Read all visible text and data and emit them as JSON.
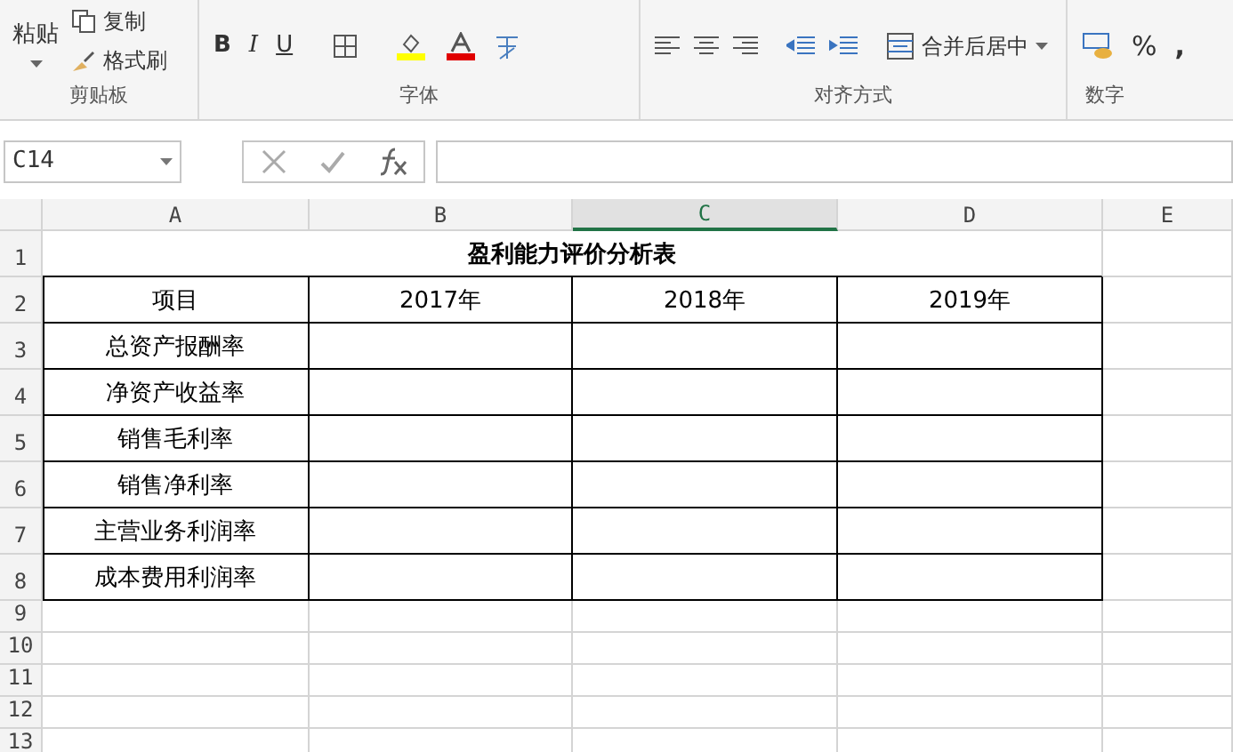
{
  "ribbon": {
    "clipboard": {
      "paste": "粘贴",
      "copy": "复制",
      "format_painter": "格式刷",
      "label": "剪贴板"
    },
    "font": {
      "bold": "B",
      "italic": "I",
      "underline": "U",
      "label": "字体"
    },
    "alignment": {
      "merge": "合并后居中",
      "label": "对齐方式"
    },
    "number": {
      "percent": "%",
      "comma": ",",
      "label": "数字"
    }
  },
  "formula_bar": {
    "name_box": "C14"
  },
  "sheet": {
    "columns": [
      {
        "label": "A",
        "selected": false
      },
      {
        "label": "B",
        "selected": false
      },
      {
        "label": "C",
        "selected": true
      },
      {
        "label": "D",
        "selected": false
      },
      {
        "label": "E",
        "selected": false
      }
    ],
    "rows": [
      {
        "header": "1",
        "kind": "title",
        "title": "盈利能力评价分析表"
      },
      {
        "header": "2",
        "kind": "table",
        "cells": [
          "项目",
          "2017年",
          "2018年",
          "2019年"
        ]
      },
      {
        "header": "3",
        "kind": "table",
        "cells": [
          "总资产报酬率"
        ]
      },
      {
        "header": "4",
        "kind": "table",
        "cells": [
          "净资产收益率"
        ]
      },
      {
        "header": "5",
        "kind": "table",
        "cells": [
          "销售毛利率"
        ]
      },
      {
        "header": "6",
        "kind": "table",
        "cells": [
          "销售净利率"
        ]
      },
      {
        "header": "7",
        "kind": "table",
        "cells": [
          "主营业务利润率"
        ]
      },
      {
        "header": "8",
        "kind": "table",
        "cells": [
          "成本费用利润率"
        ]
      },
      {
        "header": "9",
        "kind": "empty"
      },
      {
        "header": "10",
        "kind": "empty"
      },
      {
        "header": "11",
        "kind": "empty"
      },
      {
        "header": "12",
        "kind": "empty"
      },
      {
        "header": "13",
        "kind": "empty"
      }
    ]
  }
}
